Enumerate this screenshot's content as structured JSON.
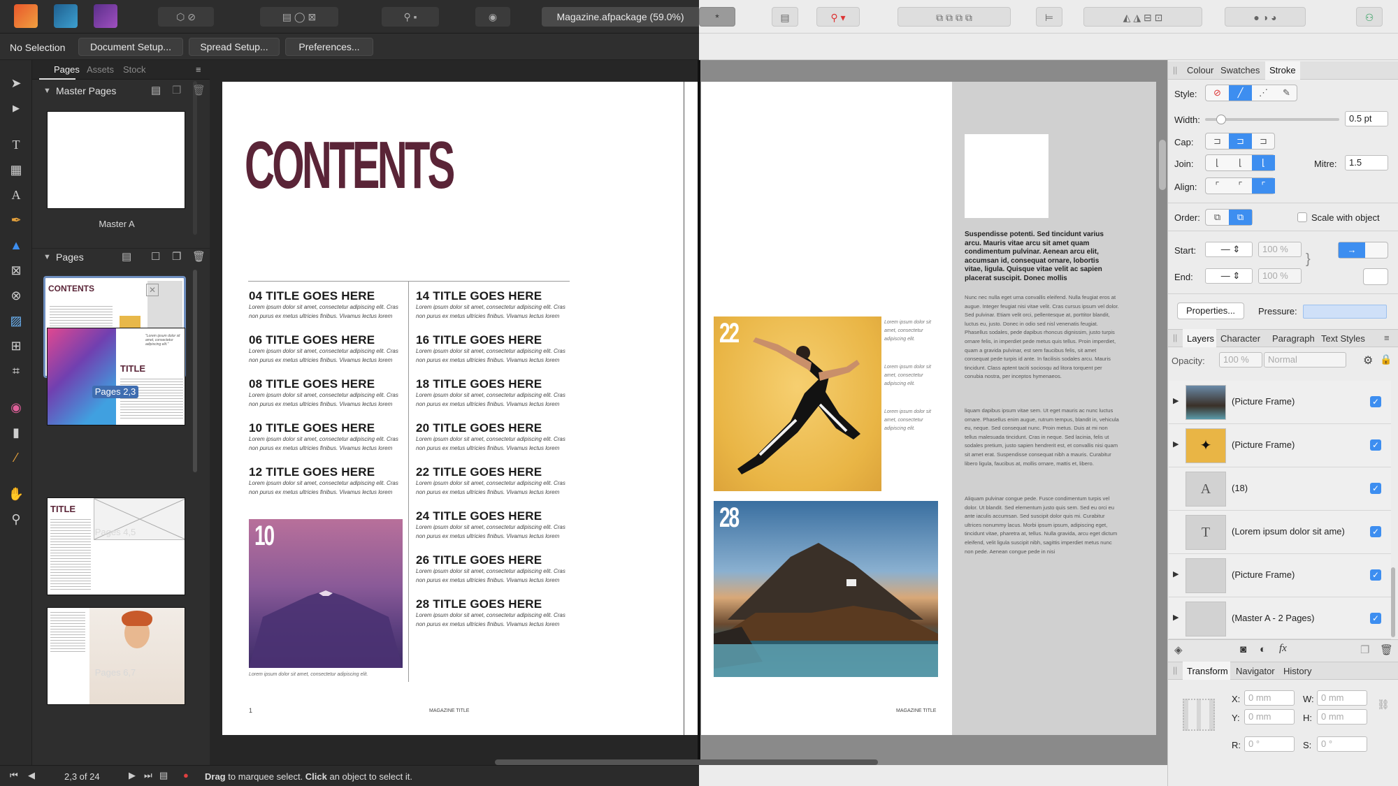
{
  "app": {
    "doc_tab": "Magazine.afpackage (59.0%)",
    "star": "*"
  },
  "context_toolbar": {
    "selection": "No Selection",
    "document_setup": "Document Setup...",
    "spread_setup": "Spread Setup...",
    "preferences": "Preferences..."
  },
  "pages_panel": {
    "tabs": [
      "Pages",
      "Assets",
      "Stock"
    ],
    "master_pages_title": "Master Pages",
    "master_label": "Master A",
    "pages_title": "Pages",
    "spreads": [
      {
        "label": "Pages 2,3",
        "selected": true
      },
      {
        "label": "Pages 4,5",
        "selected": false
      },
      {
        "label": "Pages 6,7",
        "selected": false
      }
    ],
    "thumb_texts": {
      "contents": "CONTENTS",
      "title": "TITLE",
      "quote": "\"Lorem ipsum dolor sit amet, consectetur adipiscing elit.\""
    }
  },
  "left_page": {
    "heading": "CONTENTS",
    "heading_color": "#5a2437",
    "body_text": "Lorem ipsum dolor sit amet, consectetur adipiscing elit. Cras non purus ex metus ultricies finibus. Vivamus lectus lorem",
    "toc_left": [
      "04 TITLE GOES HERE",
      "06 TITLE GOES HERE",
      "08 TITLE GOES HERE",
      "10 TITLE GOES HERE",
      "12 TITLE GOES HERE"
    ],
    "toc_right": [
      "14 TITLE GOES HERE",
      "16 TITLE GOES HERE",
      "18 TITLE GOES HERE",
      "20 TITLE GOES HERE",
      "22 TITLE GOES HERE",
      "24 TITLE GOES HERE",
      "26 TITLE GOES HERE",
      "28 TITLE GOES HERE"
    ],
    "image_number": "10",
    "image_caption": "Lorem ipsum dolor sit amet, consectetur adipiscing elit.",
    "page_number": "1",
    "footer": "MAGAZINE TITLE"
  },
  "right_page": {
    "image1_number": "22",
    "image2_number": "28",
    "side_caption": "Lorem ipsum dolor sit amet, consectetur adipiscing elit.",
    "bold_paragraph": "Suspendisse potenti. Sed tincidunt varius arcu. Mauris vitae arcu sit amet quam condimentum pulvinar. Aenean arcu elit, accumsan id, consequat ornare, lobortis vitae, ligula. Quisque vitae velit ac sapien placerat suscipit. Donec mollis",
    "para1": "Nunc nec nulla eget urna convallis eleifend. Nulla feugiat eros at augue. Integer feugiat nisi vitae velit. Cras cursus ipsum vel dolor. Sed pulvinar. Etiam velit orci, pellentesque at, porttitor blandit, luctus eu, justo. Donec in odio sed nisl venenatis feugiat. Phasellus sodales, pede dapibus rhoncus dignissim, justo turpis ornare felis, in imperdiet pede metus quis tellus. Proin imperdiet, quam a gravida pulvinar, est sem faucibus felis, sit amet consequat pede turpis id ante. In facilisis sodales arcu. Mauris tincidunt. Class aptent taciti sociosqu ad litora torquent per conubia nostra, per inceptos hymenaeos.",
    "para2": "liquam dapibus ipsum vitae sem. Ut eget mauris ac nunc luctus ornare. Phasellus enim augue, rutrum tempus, blandit in, vehicula eu, neque. Sed consequat nunc. Proin metus. Duis at mi non tellus malesuada tincidunt. Cras in neque. Sed lacinia, felis ut sodales pretium, justo sapien hendrerit est, et convallis nisi quam sit amet erat. Suspendisse consequat nibh a mauris. Curabitur libero ligula, faucibus at, mollis ornare, mattis et, libero.",
    "para3": "Aliquam pulvinar congue pede. Fusce condimentum turpis vel dolor. Ut blandit. Sed elementum justo quis sem. Sed eu orci eu ante iaculis accumsan. Sed suscipit dolor quis mi. Curabitur ultrices nonummy lacus. Morbi ipsum ipsum, adipiscing eget, tincidunt vitae, pharetra at, tellus. Nulla gravida, arcu eget dictum eleifend, velit ligula suscipit nibh, sagittis imperdiet metus nunc non pede. Aenean congue pede in nisi",
    "footer": "MAGAZINE TITLE"
  },
  "stroke_panel": {
    "tabs": [
      "Colour",
      "Swatches",
      "Stroke"
    ],
    "style_label": "Style:",
    "width_label": "Width:",
    "width_value": "0.5 pt",
    "cap_label": "Cap:",
    "join_label": "Join:",
    "mitre_label": "Mitre:",
    "mitre_value": "1.5",
    "align_label": "Align:",
    "order_label": "Order:",
    "scale_label": "Scale with object",
    "start_label": "Start:",
    "end_label": "End:",
    "start_pct": "100 %",
    "end_pct": "100 %",
    "properties_button": "Properties...",
    "pressure_label": "Pressure:",
    "accent": "#3d8ef0"
  },
  "layers_panel": {
    "tabs": [
      "Layers",
      "Character",
      "Paragraph",
      "Text Styles"
    ],
    "opacity_label": "Opacity:",
    "opacity_value": "100 %",
    "blend_mode": "Normal",
    "layers": [
      {
        "name": "(Picture Frame)",
        "thumb": "mountain",
        "expandable": true
      },
      {
        "name": "(Picture Frame)",
        "thumb": "runner",
        "expandable": true
      },
      {
        "name": "(18)",
        "thumb": "A",
        "expandable": false
      },
      {
        "name": "(Lorem ipsum dolor sit ame)",
        "thumb": "T",
        "expandable": false
      },
      {
        "name": "(Picture Frame)",
        "thumb": "blank",
        "expandable": true
      },
      {
        "name": "(Master A - 2 Pages)",
        "thumb": "blank",
        "expandable": true
      }
    ],
    "fx_label": "fx"
  },
  "transform_panel": {
    "tabs": [
      "Transform",
      "Navigator",
      "History"
    ],
    "x_label": "X:",
    "x_value": "0 mm",
    "y_label": "Y:",
    "y_value": "0 mm",
    "w_label": "W:",
    "w_value": "0 mm",
    "h_label": "H:",
    "h_value": "0 mm",
    "r_label": "R:",
    "r_value": "0 °",
    "s_label": "S:",
    "s_value": "0 °"
  },
  "statusbar": {
    "page_indicator": "2,3 of 24",
    "hint_drag": "Drag",
    "hint_mid": " to marquee select. ",
    "hint_click": "Click",
    "hint_end": " an object to select it."
  }
}
